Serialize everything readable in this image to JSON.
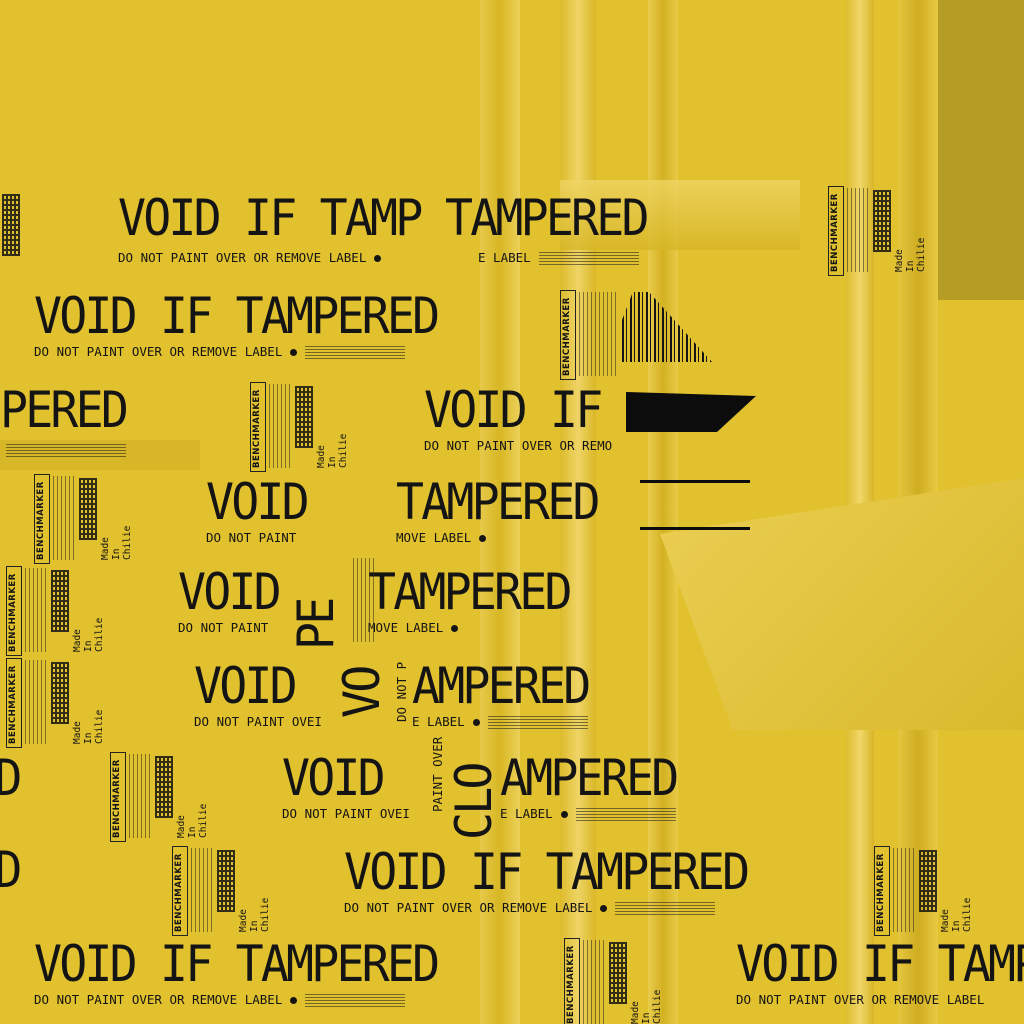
{
  "texture": {
    "base_color": "#e2c12e",
    "ink_color": "#141414",
    "label": {
      "headline": "VOID IF TAMPERED",
      "subline": "DO NOT PAINT OVER OR REMOVE LABEL",
      "brand": "BENCHMARKER",
      "made_in": "Made In Chilie"
    },
    "fragments": {
      "top_headline_a": "VOID IF TAMP",
      "top_headline_b": "TAMPERED",
      "tail_pered": "PERED",
      "tail_red": "RED",
      "void_if": "VOID IF",
      "void": "VOID",
      "tampered": "TAMPERED",
      "ampered": "AMPERED",
      "do_not_paint": "DO NOT PAINT",
      "do_not_paint_ove": "DO NOT PAINT OVEI",
      "move_label": "MOVE LABEL",
      "e_label": "E LABEL",
      "rem": "DO NOT PAINT OVER OR REMO",
      "rot_pe": "PE",
      "rot_vo": "VO",
      "rot_do_not_p": "DO NOT P",
      "rot_paint_over": "PAINT OVER",
      "rot_cl": "CLO"
    }
  }
}
